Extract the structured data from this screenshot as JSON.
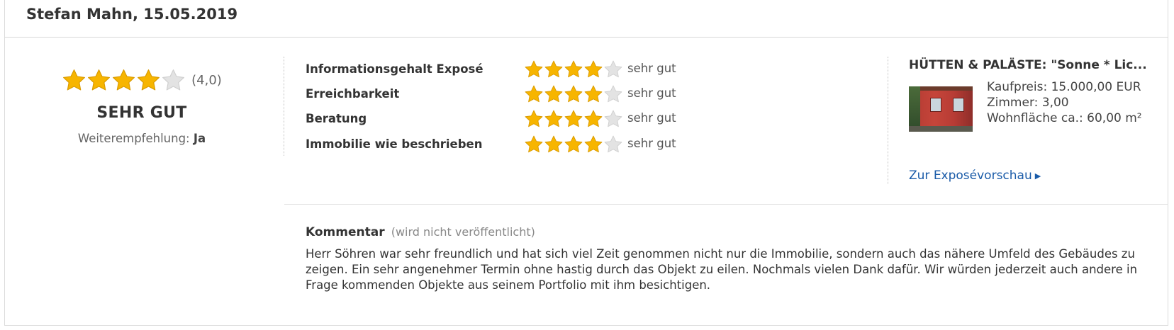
{
  "review": {
    "header": "Stefan Mahn, 15.05.2019",
    "overall": {
      "rating": 4,
      "max": 5,
      "score_text": "(4,0)",
      "verdict": "SEHR GUT",
      "recommend_label": "Weiterempfehlung:",
      "recommend_value": "Ja"
    },
    "criteria": [
      {
        "label": "Informationsgehalt Exposé",
        "rating": 4,
        "text": "sehr gut"
      },
      {
        "label": "Erreichbarkeit",
        "rating": 4,
        "text": "sehr gut"
      },
      {
        "label": "Beratung",
        "rating": 4,
        "text": "sehr gut"
      },
      {
        "label": "Immobilie wie beschrieben",
        "rating": 4,
        "text": "sehr gut"
      }
    ],
    "property": {
      "title": "HÜTTEN & PALÄSTE: \"Sonne * Lic...",
      "facts": [
        "Kaufpreis: 15.000,00 EUR",
        "Zimmer: 3,00",
        "Wohnfläche ca.: 60,00 m²"
      ],
      "link_label": "Zur Exposévorschau"
    },
    "comment": {
      "title": "Kommentar",
      "note": "(wird nicht veröffentlicht)",
      "text": "Herr Söhren war sehr freundlich und hat sich viel Zeit genommen nicht nur die Immobilie, sondern auch das nähere Umfeld des Gebäudes zu zeigen. Ein sehr angenehmer Termin ohne hastig durch das Objekt zu eilen. Nochmals vielen Dank dafür. Wir würden jederzeit auch andere in Frage kommenden Objekte aus seinem Portfolio mit ihm besichtigen."
    }
  },
  "colors": {
    "star_filled": "#f7b500",
    "star_empty": "#e3e3e3",
    "link": "#1a5ba8"
  },
  "icons": {
    "star": "star-icon",
    "link_arrow": "triangle-right-icon"
  }
}
